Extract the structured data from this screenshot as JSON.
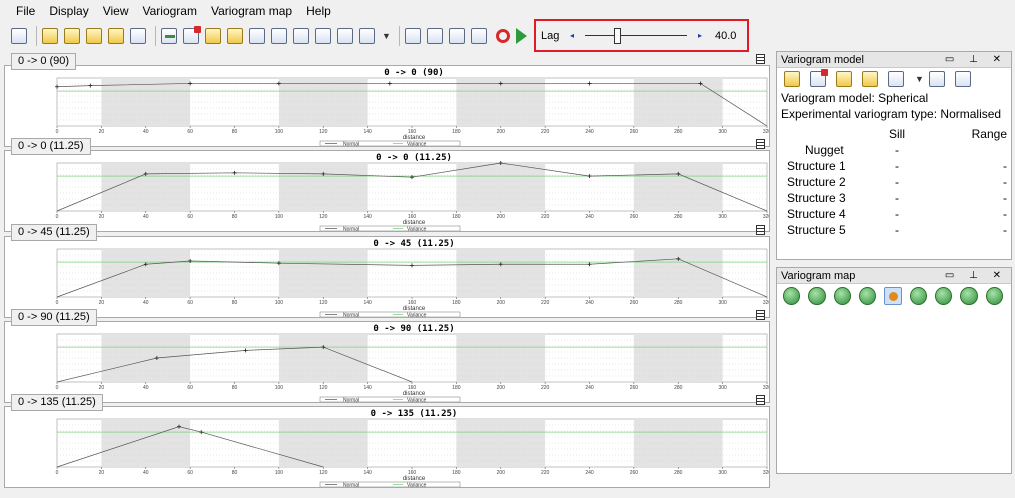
{
  "menu": {
    "items": [
      "File",
      "Display",
      "View",
      "Variogram",
      "Variogram map",
      "Help"
    ]
  },
  "toolbar": {
    "lag": {
      "label": "Lag",
      "value": "40.0",
      "left_arrow": "◂",
      "right_arrow": "▸",
      "position": 0.3
    }
  },
  "plots": [
    {
      "tab": "0 -> 0 (90)",
      "title": "0 -> 0 (90)",
      "xlabel": "distance",
      "legend": [
        "Normal",
        "Variance"
      ],
      "points": [
        [
          0,
          1.8
        ],
        [
          15,
          1.85
        ],
        [
          60,
          1.95
        ],
        [
          100,
          1.95
        ],
        [
          150,
          1.95
        ],
        [
          200,
          1.95
        ],
        [
          240,
          1.95
        ],
        [
          290,
          1.95
        ],
        [
          320,
          0
        ]
      ]
    },
    {
      "tab": "0 -> 0 (11.25)",
      "title": "0 -> 0 (11.25)",
      "xlabel": "distance",
      "legend": [
        "Normal",
        "Variance"
      ],
      "points": [
        [
          0,
          0
        ],
        [
          40,
          1.7
        ],
        [
          80,
          1.75
        ],
        [
          120,
          1.7
        ],
        [
          160,
          1.55
        ],
        [
          200,
          2.2
        ],
        [
          240,
          1.6
        ],
        [
          280,
          1.7
        ],
        [
          320,
          0
        ]
      ]
    },
    {
      "tab": "0 -> 45 (11.25)",
      "title": "0 -> 45 (11.25)",
      "xlabel": "distance",
      "legend": [
        "Normal",
        "Variance"
      ],
      "points": [
        [
          0,
          0
        ],
        [
          40,
          1.5
        ],
        [
          60,
          1.65
        ],
        [
          100,
          1.55
        ],
        [
          160,
          1.45
        ],
        [
          200,
          1.5
        ],
        [
          240,
          1.5
        ],
        [
          280,
          1.75
        ],
        [
          320,
          0
        ]
      ]
    },
    {
      "tab": "0 -> 90 (11.25)",
      "title": "0 -> 90 (11.25)",
      "xlabel": "distance",
      "legend": [
        "Normal",
        "Variance"
      ],
      "points": [
        [
          0,
          0
        ],
        [
          45,
          1.1
        ],
        [
          85,
          1.45
        ],
        [
          120,
          1.6
        ],
        [
          160,
          0
        ]
      ]
    },
    {
      "tab": "0 -> 135 (11.25)",
      "title": "0 -> 135 (11.25)",
      "xlabel": "distance",
      "legend": [
        "Normal",
        "Variance"
      ],
      "points": [
        [
          0,
          0
        ],
        [
          55,
          1.85
        ],
        [
          65,
          1.6
        ],
        [
          120,
          0
        ]
      ]
    }
  ],
  "axis": {
    "x_ticks": [
      "0",
      "20",
      "40",
      "60",
      "80",
      "100",
      "120",
      "140",
      "160",
      "180",
      "200",
      "220",
      "240",
      "260",
      "280",
      "300",
      "320"
    ],
    "x_range": [
      0,
      320
    ],
    "y_range": [
      0,
      2.2
    ],
    "band_pairs": [
      [
        20,
        60
      ],
      [
        100,
        140
      ],
      [
        180,
        220
      ],
      [
        260,
        300
      ]
    ]
  },
  "variogram_model": {
    "title": "Variogram model",
    "model_line": "Variogram model: Spherical",
    "exp_line": "Experimental variogram type: Normalised",
    "col_sill": "Sill",
    "col_range": "Range",
    "rows": [
      {
        "name": "Nugget",
        "sill": "-",
        "range": ""
      },
      {
        "name": "Structure 1",
        "sill": "-",
        "range": "-"
      },
      {
        "name": "Structure 2",
        "sill": "-",
        "range": "-"
      },
      {
        "name": "Structure 3",
        "sill": "-",
        "range": "-"
      },
      {
        "name": "Structure 4",
        "sill": "-",
        "range": "-"
      },
      {
        "name": "Structure 5",
        "sill": "-",
        "range": "-"
      }
    ]
  },
  "variogram_map": {
    "title": "Variogram map"
  }
}
